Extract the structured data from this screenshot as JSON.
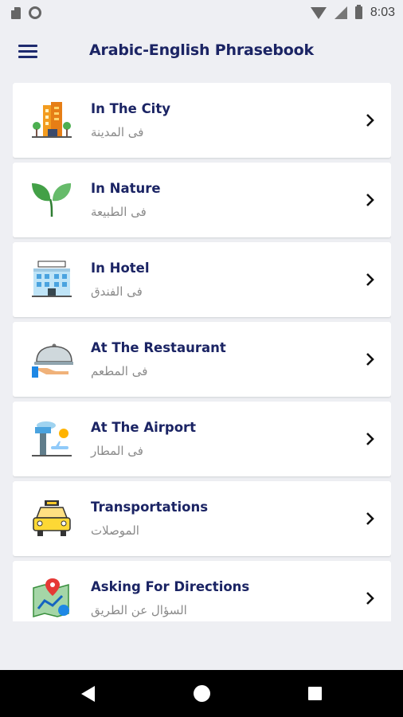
{
  "status_bar": {
    "time": "8:03"
  },
  "app_bar": {
    "title": "Arabic-English Phrasebook"
  },
  "categories": [
    {
      "title": "In The City",
      "subtitle": "فى المدينة",
      "icon": "city-buildings-icon"
    },
    {
      "title": "In Nature",
      "subtitle": "فى الطبيعة",
      "icon": "leaves-sprout-icon"
    },
    {
      "title": "In Hotel",
      "subtitle": "فى الفندق",
      "icon": "hotel-building-icon"
    },
    {
      "title": "At The Restaurant",
      "subtitle": "فى المطعم",
      "icon": "food-cloche-icon"
    },
    {
      "title": "At The Airport",
      "subtitle": "فى المطار",
      "icon": "airport-tower-icon"
    },
    {
      "title": "Transportations",
      "subtitle": "الموصلات",
      "icon": "taxi-icon"
    },
    {
      "title": "Asking For Directions",
      "subtitle": "السؤال عن الطريق",
      "icon": "map-pin-icon"
    }
  ],
  "colors": {
    "title": "#1b2464",
    "subtitle": "#8a8a8a",
    "background": "#eeeff3"
  }
}
